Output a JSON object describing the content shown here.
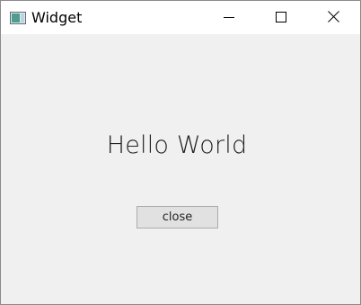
{
  "window": {
    "title": "Widget",
    "icons": {
      "app": "app-window-icon",
      "minimize": "minimize-icon",
      "maximize": "maximize-icon",
      "close": "close-icon"
    }
  },
  "content": {
    "heading": "Hello World",
    "close_button_label": "close"
  },
  "colors": {
    "titlebar": "#ffffff",
    "client_area": "#f0f0f0",
    "button_face": "#e1e1e1",
    "button_border": "#adadad",
    "text": "#222222"
  }
}
